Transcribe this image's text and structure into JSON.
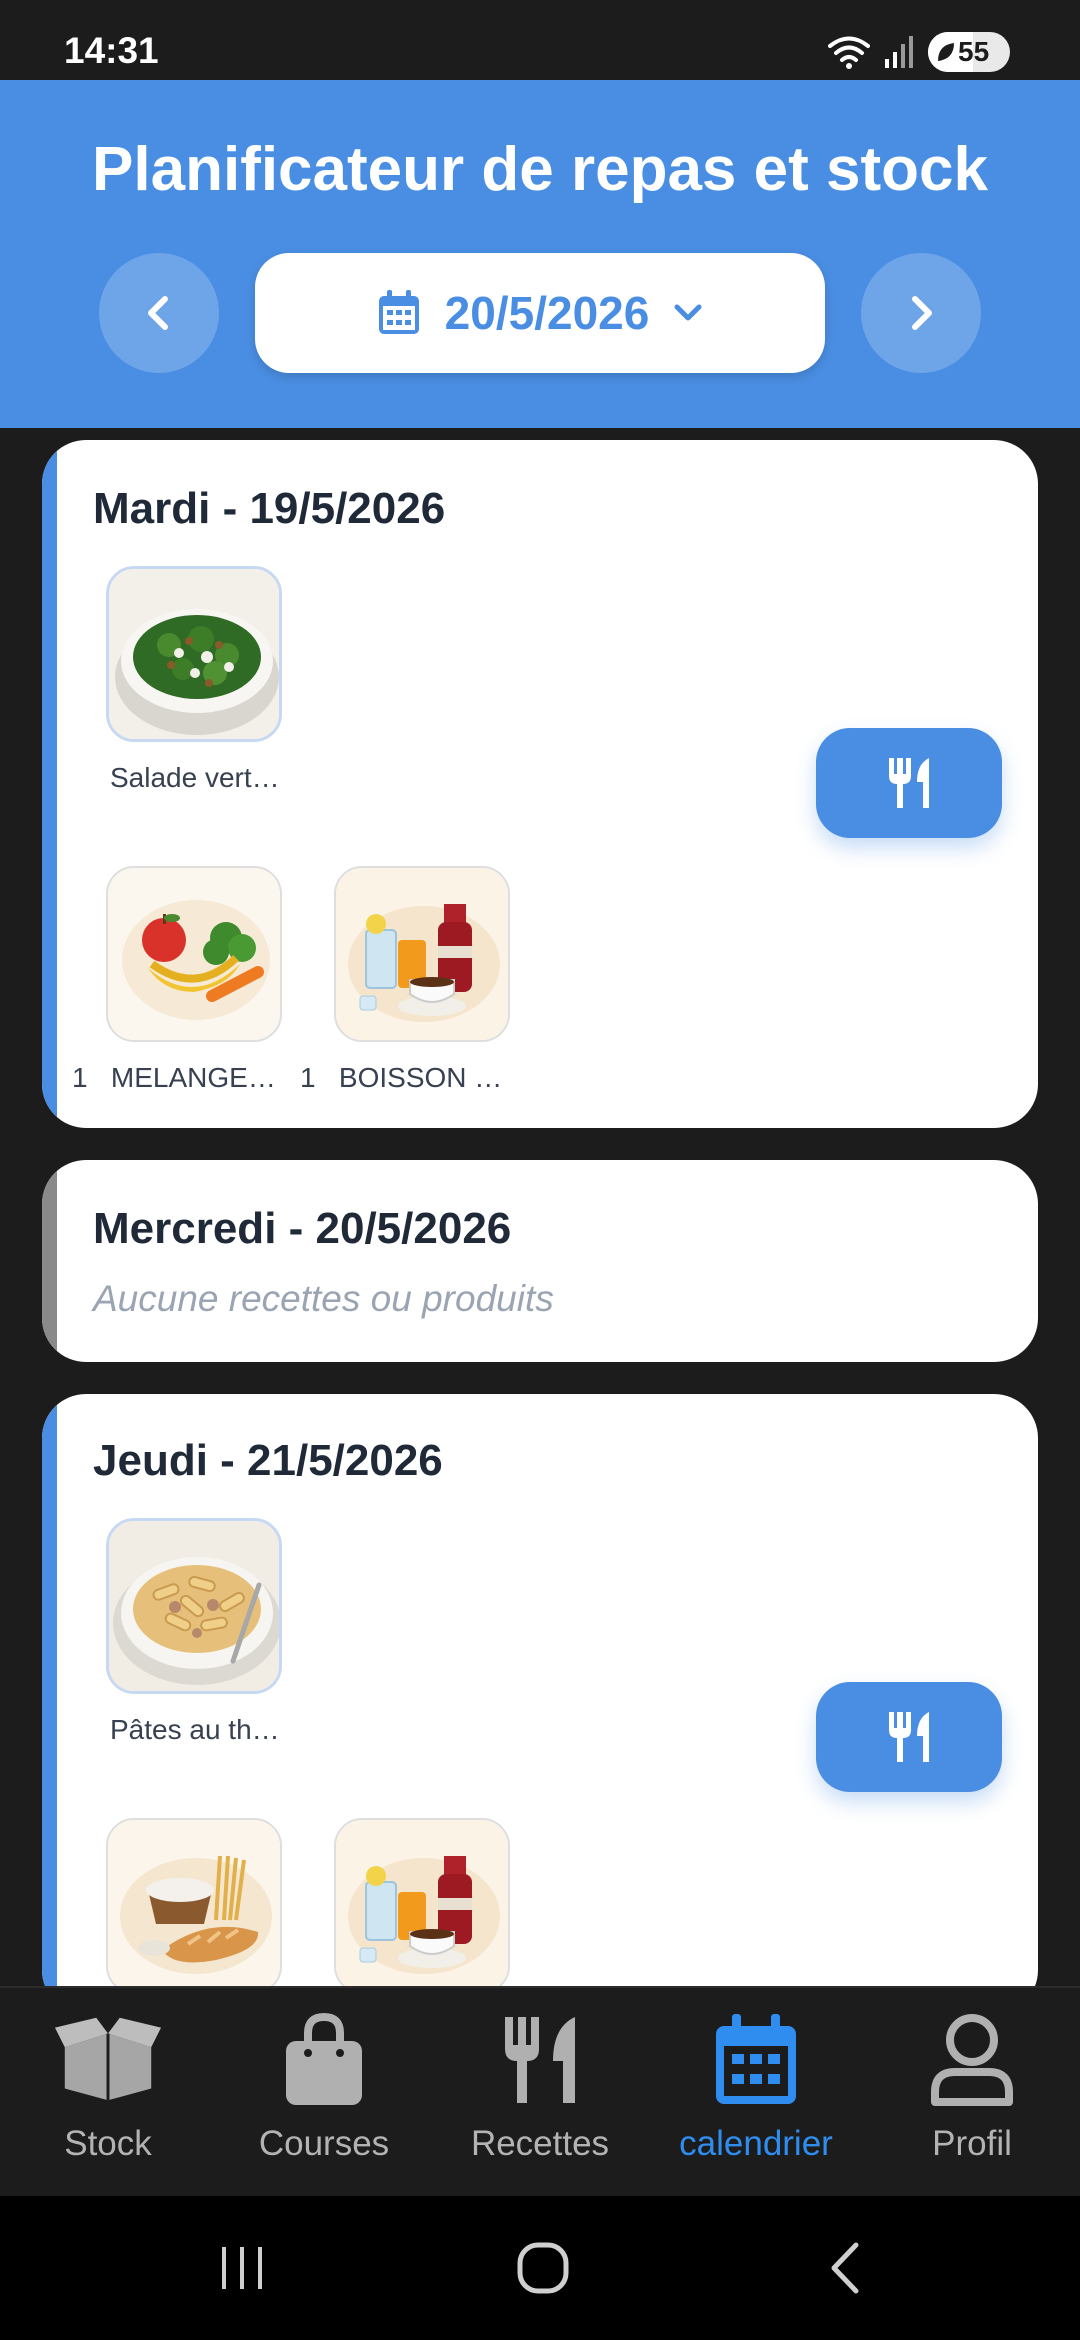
{
  "status_bar": {
    "time": "14:31",
    "battery": "55",
    "battery_fraction": 0.55
  },
  "header": {
    "title": "Planificateur de repas et stock",
    "date": "20/5/2026"
  },
  "days": [
    {
      "title": "Mardi - 19/5/2026",
      "recipes": [
        {
          "label": "Salade vert…",
          "image": "salad"
        }
      ],
      "products": [
        {
          "qty": "1",
          "label": "MELANGE…",
          "image": "fruits-vegetables"
        },
        {
          "qty": "1",
          "label": "BOISSON …",
          "image": "drinks"
        }
      ]
    },
    {
      "title": "Mercredi - 20/5/2026",
      "empty_text": "Aucune recettes ou produits"
    },
    {
      "title": "Jeudi - 21/5/2026",
      "recipes": [
        {
          "label": "Pâtes au th…",
          "image": "pasta"
        }
      ],
      "products": [
        {
          "image": "bread-grains"
        },
        {
          "image": "drinks"
        }
      ]
    }
  ],
  "bottom_nav": [
    {
      "label": "Stock",
      "icon": "box-icon"
    },
    {
      "label": "Courses",
      "icon": "bag-icon"
    },
    {
      "label": "Recettes",
      "icon": "fork-knife-icon"
    },
    {
      "label": "calendrier",
      "icon": "calendar-icon",
      "active": true
    },
    {
      "label": "Profil",
      "icon": "person-icon"
    }
  ],
  "colors": {
    "primary": "#4a8ee3",
    "active_nav": "#2f8df0",
    "bg_dark": "#1c1c1c",
    "card_accent_muted": "#8a8a8a"
  }
}
